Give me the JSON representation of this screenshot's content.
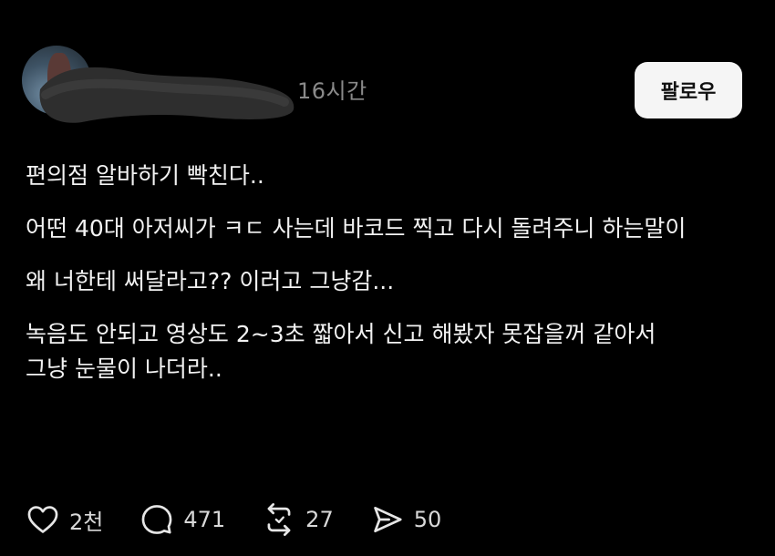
{
  "post": {
    "time": "16시간",
    "follow_label": "팔로우",
    "paragraphs": [
      "편의점 알바하기 빡친다..",
      "어떤 40대 아저씨가 ㅋㄷ 사는데 바코드 찍고 다시 돌려주니 하는말이",
      "왜 너한테 써달라고?? 이러고 그냥감...",
      "녹음도 안되고 영상도 2~3초 짧아서 신고 해봤자 못잡을꺼 같아서 그냥 눈물이 나더라.."
    ]
  },
  "actions": {
    "like": {
      "icon": "heart-icon",
      "count": "2천"
    },
    "reply": {
      "icon": "comment-icon",
      "count": "471"
    },
    "repost": {
      "icon": "repost-icon",
      "count": "27"
    },
    "share": {
      "icon": "send-icon",
      "count": "50"
    }
  },
  "colors": {
    "background": "#000000",
    "text": "#f2f2f2",
    "muted": "#8a8a8a",
    "button_bg": "#f5f5f5"
  }
}
